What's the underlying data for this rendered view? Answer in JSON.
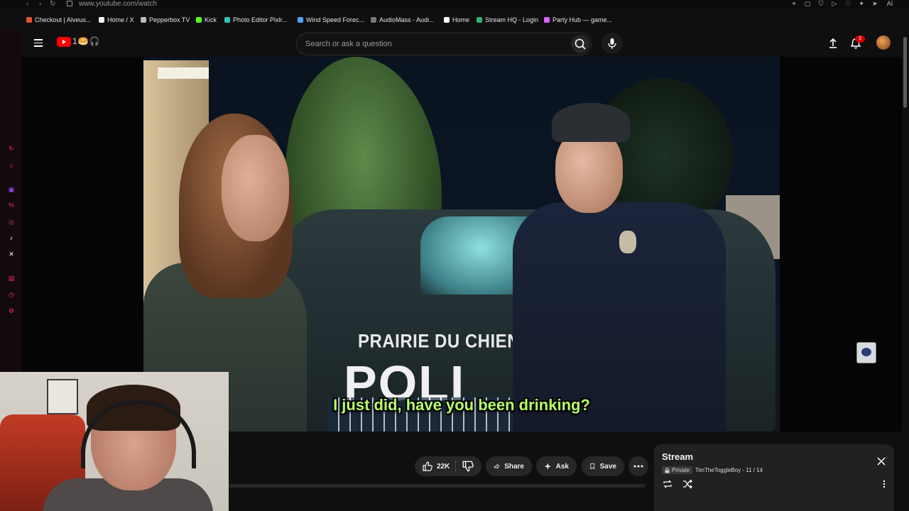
{
  "browser": {
    "url": "www.youtube.com/watch",
    "bookmarks": [
      {
        "label": "Checkout | Alveus...",
        "color": "#e0522f"
      },
      {
        "label": "Home / X",
        "color": "#ffffff"
      },
      {
        "label": "Pepperbox TV",
        "color": "#bbbbbb"
      },
      {
        "label": "Kick",
        "color": "#53fc18"
      },
      {
        "label": "Photo Editor Pixlr...",
        "color": "#33c2b5"
      },
      {
        "label": "Wind Speed Forec...",
        "color": "#4ea1ff"
      },
      {
        "label": "AudioMass - Audi...",
        "color": "#777777"
      },
      {
        "label": "Home",
        "color": "#ffffff"
      },
      {
        "label": "Stream HQ - Login",
        "color": "#30b070"
      },
      {
        "label": "Party Hub — game...",
        "color": "#d466ff"
      }
    ],
    "toolbar_ai_label": "AI"
  },
  "header": {
    "search_placeholder": "Search or ask a question",
    "logo_doodle": "1🥯🎧",
    "notification_count": "3"
  },
  "video": {
    "subtitle": "I just did, have you been drinking?",
    "car_text_top": "PRAIRIE DU CHIEN",
    "car_text_bottom": "POLI"
  },
  "actions": {
    "like_count": "22K",
    "share_label": "Share",
    "ask_label": "Ask",
    "save_label": "Save"
  },
  "playlist": {
    "title": "Stream",
    "privacy": "Private",
    "owner_progress": "TimTheToggleBoy - 11 / 14"
  },
  "colors": {
    "accent": "#ff0000",
    "subtitle": "#b8ff6a",
    "left_strip_icons": "#ff2d55"
  }
}
